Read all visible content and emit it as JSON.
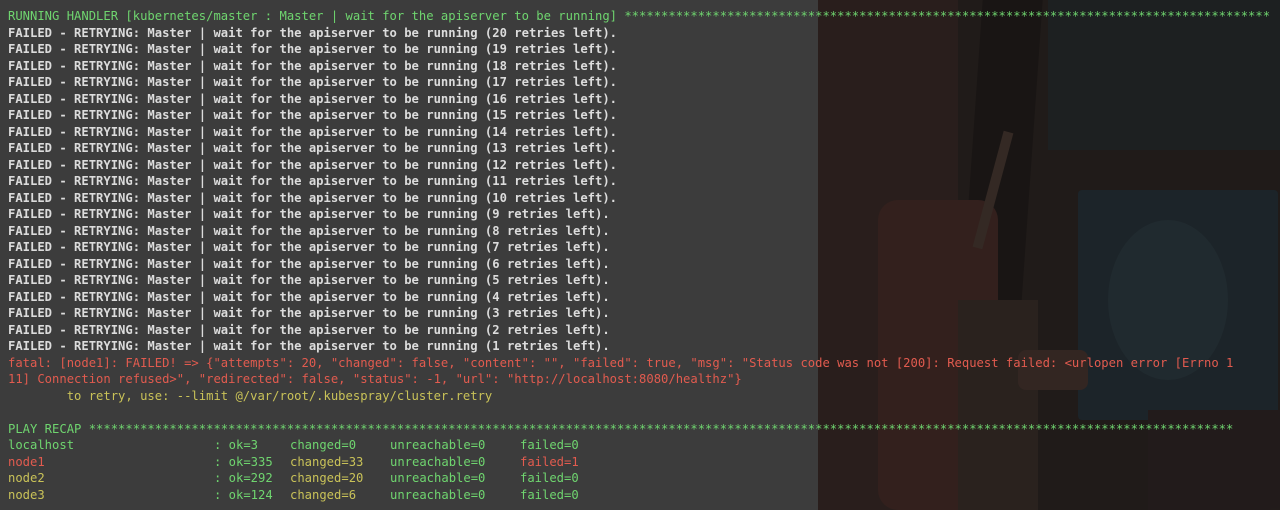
{
  "handler_header": "RUNNING HANDLER [kubernetes/master : Master | wait for the apiserver to be running] ****************************************************************************************",
  "retry_lines": [
    "FAILED - RETRYING: Master | wait for the apiserver to be running (20 retries left).",
    "FAILED - RETRYING: Master | wait for the apiserver to be running (19 retries left).",
    "FAILED - RETRYING: Master | wait for the apiserver to be running (18 retries left).",
    "FAILED - RETRYING: Master | wait for the apiserver to be running (17 retries left).",
    "FAILED - RETRYING: Master | wait for the apiserver to be running (16 retries left).",
    "FAILED - RETRYING: Master | wait for the apiserver to be running (15 retries left).",
    "FAILED - RETRYING: Master | wait for the apiserver to be running (14 retries left).",
    "FAILED - RETRYING: Master | wait for the apiserver to be running (13 retries left).",
    "FAILED - RETRYING: Master | wait for the apiserver to be running (12 retries left).",
    "FAILED - RETRYING: Master | wait for the apiserver to be running (11 retries left).",
    "FAILED - RETRYING: Master | wait for the apiserver to be running (10 retries left).",
    "FAILED - RETRYING: Master | wait for the apiserver to be running (9 retries left).",
    "FAILED - RETRYING: Master | wait for the apiserver to be running (8 retries left).",
    "FAILED - RETRYING: Master | wait for the apiserver to be running (7 retries left).",
    "FAILED - RETRYING: Master | wait for the apiserver to be running (6 retries left).",
    "FAILED - RETRYING: Master | wait for the apiserver to be running (5 retries left).",
    "FAILED - RETRYING: Master | wait for the apiserver to be running (4 retries left).",
    "FAILED - RETRYING: Master | wait for the apiserver to be running (3 retries left).",
    "FAILED - RETRYING: Master | wait for the apiserver to be running (2 retries left).",
    "FAILED - RETRYING: Master | wait for the apiserver to be running (1 retries left)."
  ],
  "fatal_line_1": "fatal: [node1]: FAILED! => {\"attempts\": 20, \"changed\": false, \"content\": \"\", \"failed\": true, \"msg\": \"Status code was not [200]: Request failed: <urlopen error [Errno 1",
  "fatal_line_2": "11] Connection refused>\", \"redirected\": false, \"status\": -1, \"url\": \"http://localhost:8080/healthz\"}",
  "retry_hint": "        to retry, use: --limit @/var/root/.kubespray/cluster.retry",
  "recap_header": "PLAY RECAP ************************************************************************************************************************************************************",
  "recap": [
    {
      "host": "localhost",
      "ok": ": ok=3",
      "changed": "changed=0",
      "unreachable": "unreachable=0",
      "failed": "failed=0",
      "status": "ok"
    },
    {
      "host": "node1",
      "ok": ": ok=335",
      "changed": "changed=33",
      "unreachable": "unreachable=0",
      "failed": "failed=1",
      "status": "failed"
    },
    {
      "host": "node2",
      "ok": ": ok=292",
      "changed": "changed=20",
      "unreachable": "unreachable=0",
      "failed": "failed=0",
      "status": "changed"
    },
    {
      "host": "node3",
      "ok": ": ok=124",
      "changed": "changed=6",
      "unreachable": "unreachable=0",
      "failed": "failed=0",
      "status": "changed"
    }
  ],
  "colors": {
    "ok": "#6fd56f",
    "changed": "#c9c258",
    "failed": "#e25b4f",
    "text": "#dcdcdc",
    "background": "#3c3c3c"
  }
}
